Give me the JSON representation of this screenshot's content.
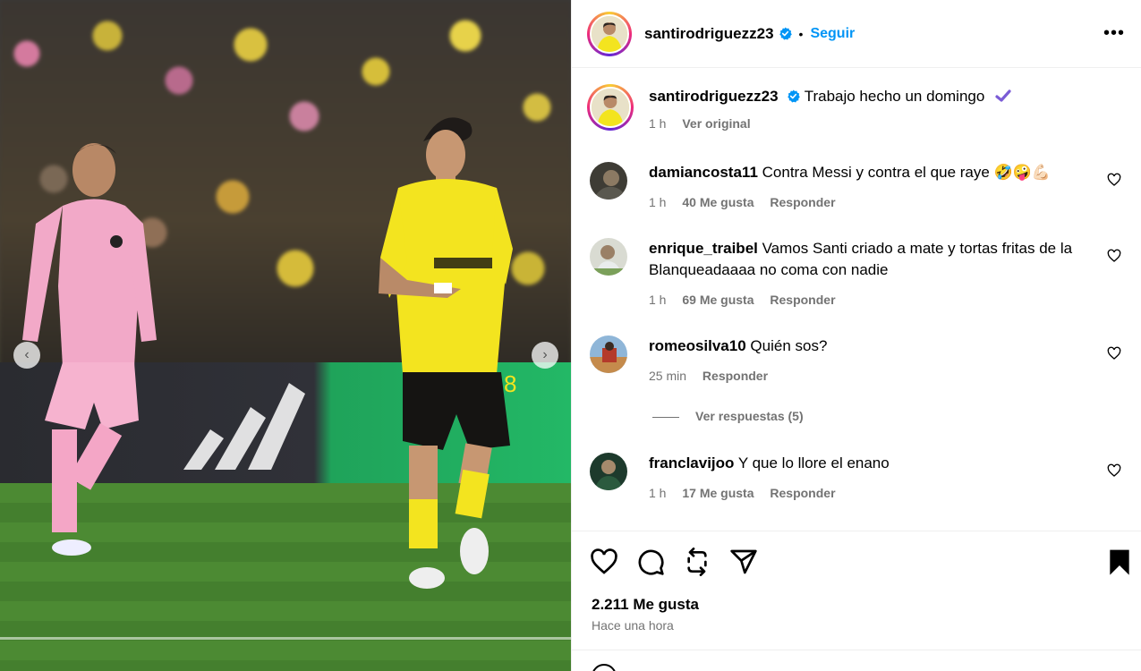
{
  "post": {
    "author": "santirodriguezz23",
    "follow_label": "Seguir",
    "dot": "•",
    "more_label": "•••",
    "caption": "Trabajo hecho un domingo",
    "caption_time": "1 h",
    "see_original": "Ver original",
    "likes": "2.211 Me gusta",
    "timestamp": "Hace una hora"
  },
  "comments": [
    {
      "user": "damiancosta11",
      "text": "Contra Messi y contra el que raye 🤣🤪💪🏻",
      "time": "1 h",
      "likes": "40 Me gusta",
      "reply": "Responder"
    },
    {
      "user": "enrique_traibel",
      "text": "Vamos Santi criado a mate y tortas fritas de la Blanqueadaaaa no coma con nadie",
      "time": "1 h",
      "likes": "69 Me gusta",
      "reply": "Responder"
    },
    {
      "user": "romeosilva10",
      "text": "Quién sos?",
      "time": "25 min",
      "reply": "Responder",
      "view_replies": "Ver respuestas (5)"
    },
    {
      "user": "franclavijoo",
      "text": "Y que lo llore el enano",
      "time": "1 h",
      "likes": "17 Me gusta",
      "reply": "Responder"
    }
  ],
  "colors": {
    "accent": "#0095f6",
    "muted": "#737373",
    "verified": "#0095f6",
    "checkmark_emoji": "#7b5cd6"
  },
  "icons": [
    "heart-icon",
    "comment-icon",
    "repost-icon",
    "share-icon",
    "bookmark-icon",
    "verified-icon",
    "chevron-left-icon",
    "chevron-right-icon",
    "more-icon"
  ]
}
